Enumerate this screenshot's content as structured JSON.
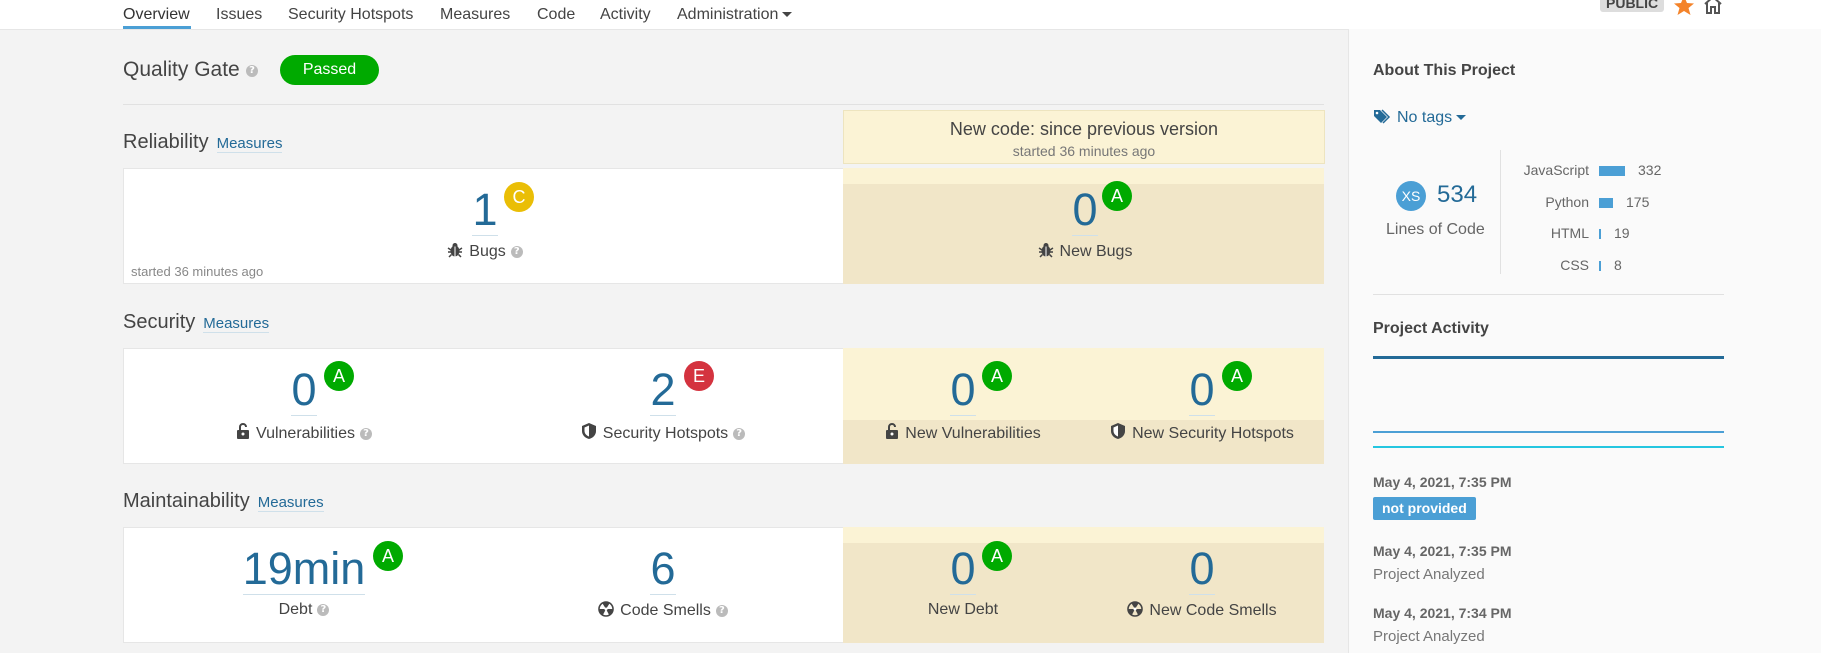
{
  "nav": {
    "items": [
      "Overview",
      "Issues",
      "Security Hotspots",
      "Measures",
      "Code",
      "Activity",
      "Administration"
    ],
    "public_badge": "PUBLIC"
  },
  "quality_gate": {
    "label": "Quality Gate",
    "status": "Passed"
  },
  "new_code": {
    "title": "New code: since previous version",
    "subtitle": "started 36 minutes ago"
  },
  "measures_link": "Measures",
  "reliability": {
    "title": "Reliability",
    "bugs": {
      "value": "1",
      "rating": "C",
      "label": "Bugs"
    },
    "new_bugs": {
      "value": "0",
      "rating": "A",
      "label": "New Bugs"
    },
    "started_note": "started 36 minutes ago"
  },
  "security": {
    "title": "Security",
    "vulnerabilities": {
      "value": "0",
      "rating": "A",
      "label": "Vulnerabilities"
    },
    "hotspots": {
      "value": "2",
      "rating": "E",
      "label": "Security Hotspots"
    },
    "new_vulnerabilities": {
      "value": "0",
      "rating": "A",
      "label": "New Vulnerabilities"
    },
    "new_hotspots": {
      "value": "0",
      "rating": "A",
      "label": "New Security Hotspots"
    }
  },
  "maintainability": {
    "title": "Maintainability",
    "debt": {
      "value": "19min",
      "rating": "A",
      "label": "Debt"
    },
    "code_smells": {
      "value": "6",
      "label": "Code Smells"
    },
    "new_debt": {
      "value": "0",
      "rating": "A",
      "label": "New Debt"
    },
    "new_code_smells": {
      "value": "0",
      "label": "New Code Smells"
    }
  },
  "sidebar": {
    "about_title": "About This Project",
    "tags_label": "No tags",
    "size_badge": "XS",
    "lines_of_code": "534",
    "lines_of_code_label": "Lines of Code",
    "languages": [
      {
        "name": "JavaScript",
        "count": "332",
        "share": 332
      },
      {
        "name": "Python",
        "count": "175",
        "share": 175
      },
      {
        "name": "HTML",
        "count": "19",
        "share": 19
      },
      {
        "name": "CSS",
        "count": "8",
        "share": 8
      }
    ],
    "activity_title": "Project Activity",
    "activity": [
      {
        "date": "May 4, 2021, 7:35 PM",
        "badge": "not provided"
      },
      {
        "date": "May 4, 2021, 7:35 PM",
        "desc": "Project Analyzed"
      },
      {
        "date": "May 4, 2021, 7:34 PM",
        "desc": "Project Analyzed"
      }
    ]
  },
  "colors": {
    "rating_a": "#00aa00",
    "rating_c": "#eabe06",
    "rating_e": "#d4333f",
    "link": "#236a97",
    "new_code_bg": "#f1e6c8"
  }
}
